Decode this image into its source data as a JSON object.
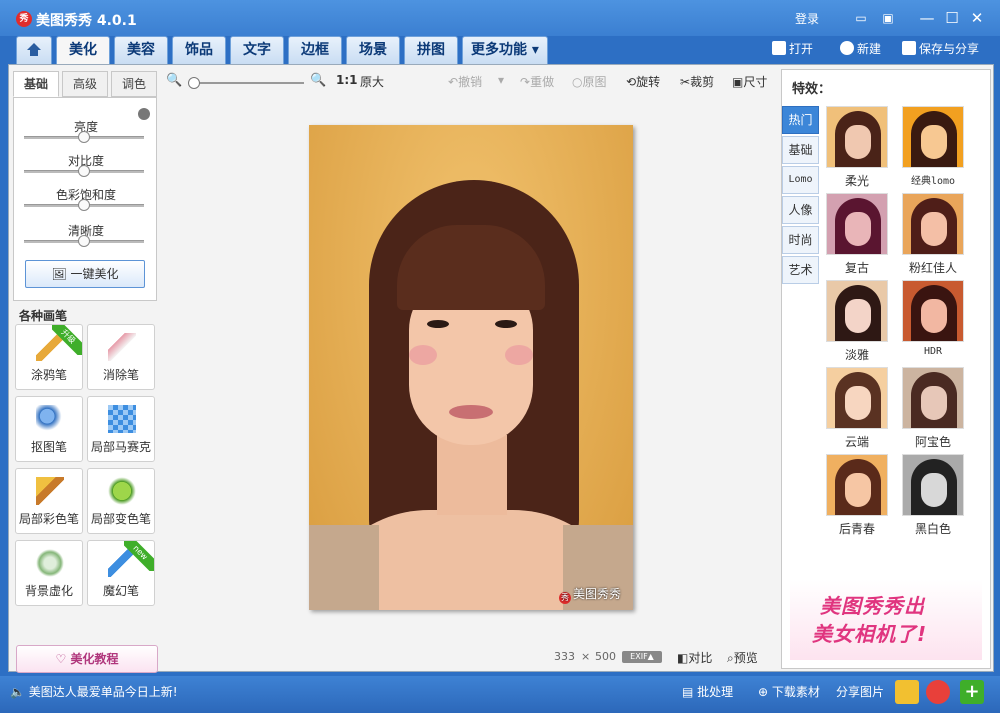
{
  "app": {
    "title": "美图秀秀 4.0.1",
    "logo_text": "秀"
  },
  "titlebar": {
    "login": "登录",
    "minimize": "—",
    "maximize": "☐",
    "close": "✕"
  },
  "tabs": [
    "美化",
    "美容",
    "饰品",
    "文字",
    "边框",
    "场景",
    "拼图",
    "更多功能"
  ],
  "top_actions": {
    "open": "打开",
    "new": "新建",
    "save": "保存与分享"
  },
  "left": {
    "subtabs": [
      "基础",
      "高级",
      "调色"
    ],
    "sliders": [
      {
        "label": "亮度",
        "value": 0.5
      },
      {
        "label": "对比度",
        "value": 0.5
      },
      {
        "label": "色彩饱和度",
        "value": 0.5
      },
      {
        "label": "清晰度",
        "value": 0.5
      }
    ],
    "onekey": "一键美化",
    "brush_title": "各种画笔",
    "brushes": [
      {
        "label": "涂鸦笔",
        "badge": "升级"
      },
      {
        "label": "消除笔",
        "badge": ""
      },
      {
        "label": "抠图笔",
        "badge": ""
      },
      {
        "label": "局部马赛克",
        "badge": ""
      },
      {
        "label": "局部彩色笔",
        "badge": ""
      },
      {
        "label": "局部变色笔",
        "badge": ""
      },
      {
        "label": "背景虚化",
        "badge": ""
      },
      {
        "label": "魔幻笔",
        "badge": "new"
      }
    ],
    "tutorial": "美化教程"
  },
  "toolbar": {
    "zoom_ratio": "1:1",
    "original_size": "原大",
    "undo": "撤销",
    "redo": "重做",
    "original": "原图",
    "rotate": "旋转",
    "crop": "裁剪",
    "resize": "尺寸"
  },
  "photo": {
    "watermark": "美图秀秀",
    "width": "333",
    "times": "×",
    "height": "500",
    "exif": "EXIF▲",
    "compare": "对比",
    "preview": "预览"
  },
  "right": {
    "title": "特效：",
    "categories": [
      "热门",
      "基础",
      "Lomo",
      "人像",
      "时尚",
      "艺术"
    ],
    "effects": [
      {
        "label": "柔光",
        "hair": "#4a2318",
        "face": "#f0c8b0",
        "bg": "#f0c07a"
      },
      {
        "label": "经典lomo",
        "hair": "#3a1a10",
        "face": "#f7c892",
        "bg": "#f2a020"
      },
      {
        "label": "复古",
        "hair": "#5a1530",
        "face": "#e9b5b8",
        "bg": "#d3a0b0"
      },
      {
        "label": "粉红佳人",
        "hair": "#4f1e18",
        "face": "#f4bfa6",
        "bg": "#e9a55a"
      },
      {
        "label": "淡雅",
        "hair": "#2e1814",
        "face": "#f3d4c8",
        "bg": "#e9c9a8"
      },
      {
        "label": "HDR",
        "hair": "#3a1410",
        "face": "#f2b7a2",
        "bg": "#c85a30"
      },
      {
        "label": "云端",
        "hair": "#5a3222",
        "face": "#f7d6c0",
        "bg": "#f5cfa0"
      },
      {
        "label": "阿宝色",
        "hair": "#4a2a22",
        "face": "#e7c7b8",
        "bg": "#ccb4a0"
      },
      {
        "label": "后青春",
        "hair": "#5a2a1a",
        "face": "#f6c6a4",
        "bg": "#f0b060"
      },
      {
        "label": "黑白色",
        "hair": "#222222",
        "face": "#d8d8d8",
        "bg": "#aaaaaa"
      }
    ],
    "ad_line1": "美图秀秀出",
    "ad_line2": "美女相机了!"
  },
  "statusbar": {
    "news": "美图达人最爱单品今日上新!",
    "batch": "批处理",
    "download": "下载素材",
    "share": "分享图片"
  }
}
